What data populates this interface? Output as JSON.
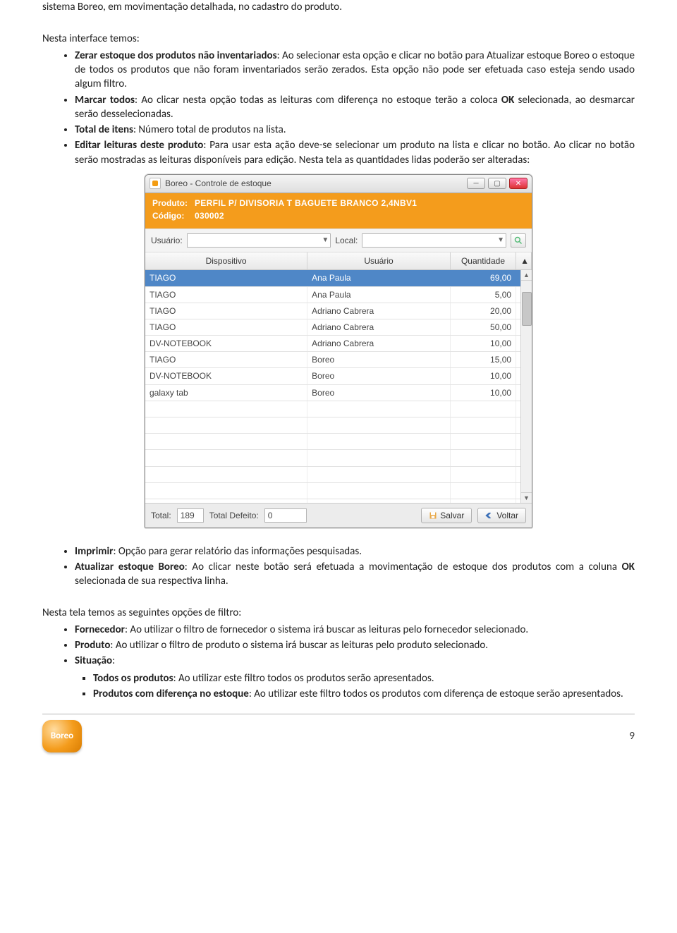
{
  "doc": {
    "intro": "sistema Boreo, em movimentação detalhada, no cadastro do produto.",
    "section1_lead": "Nesta interface temos:",
    "b1_bold": "Zerar estoque dos produtos não inventariados",
    "b1_rest": ": Ao selecionar esta opção e clicar no botão para Atualizar estoque Boreo o estoque de todos os produtos que não foram inventariados serão zerados. Esta opção não pode ser  efetuada caso esteja sendo usado algum filtro.",
    "b2_bold": "Marcar todos",
    "b2_rest": ": Ao clicar nesta opção todas as leituras com diferença no estoque terão a coloca ",
    "b2_bold2": "OK",
    "b2_rest2": " selecionada, ao desmarcar serão desselecionadas.",
    "b3_bold": "Total de itens",
    "b3_rest": ": Número total de produtos na lista.",
    "b4_bold": "Editar leituras deste produto",
    "b4_rest": ": Para usar esta ação deve-se selecionar um produto na lista e clicar no botão. Ao clicar no botão serão mostradas as leituras disponíveis para edição. Nesta tela as quantidades lidas poderão ser alteradas:",
    "b5_bold": "Imprimir",
    "b5_rest": ": Opção para gerar relatório das informações pesquisadas.",
    "b6_bold": "Atualizar estoque Boreo",
    "b6_rest": ": Ao clicar neste botão será efetuada a movimentação de estoque dos produtos com a coluna ",
    "b6_bold2": "OK",
    "b6_rest2": " selecionada de sua respectiva linha.",
    "section2_lead": "Nesta tela temos as seguintes opções de filtro:",
    "f1_bold": "Fornecedor",
    "f1_rest": ": Ao utilizar o filtro de fornecedor o sistema irá buscar as leituras pelo fornecedor selecionado.",
    "f2_bold": "Produto",
    "f2_rest": ": Ao utilizar o filtro de produto o sistema irá buscar as leituras pelo produto selecionado.",
    "f3_bold": "Situação",
    "f3_rest": ":",
    "s1_bold": "Todos os produtos",
    "s1_rest": ": Ao utilizar este filtro todos os produtos serão apresentados.",
    "s2_bold": "Produtos com diferença no estoque",
    "s2_rest": ": Ao utilizar este filtro todos os produtos com diferença de estoque serão apresentados."
  },
  "win": {
    "title": "Boreo - Controle de estoque",
    "prod_label": "Produto:",
    "prod_value": "PERFIL P/ DIVISORIA T  BAGUETE BRANCO 2,4NBV1",
    "code_label": "Código:",
    "code_value": "030002",
    "user_label": "Usuário:",
    "local_label": "Local:",
    "col1": "Dispositivo",
    "col2": "Usuário",
    "col3": "Quantidade",
    "sort": "▲",
    "rows": [
      {
        "d": "TIAGO",
        "u": "Ana Paula",
        "q": "69,00"
      },
      {
        "d": "TIAGO",
        "u": "Ana Paula",
        "q": "5,00"
      },
      {
        "d": "TIAGO",
        "u": "Adriano Cabrera",
        "q": "20,00"
      },
      {
        "d": "TIAGO",
        "u": "Adriano Cabrera",
        "q": "50,00"
      },
      {
        "d": "DV-NOTEBOOK",
        "u": "Adriano Cabrera",
        "q": "10,00"
      },
      {
        "d": "TIAGO",
        "u": "Boreo",
        "q": "15,00"
      },
      {
        "d": "DV-NOTEBOOK",
        "u": "Boreo",
        "q": "10,00"
      },
      {
        "d": "galaxy tab",
        "u": "Boreo",
        "q": "10,00"
      }
    ],
    "total_label": "Total:",
    "total_value": "189",
    "defeito_label": "Total Defeito:",
    "defeito_value": "0",
    "save": "Salvar",
    "back": "Voltar"
  },
  "footer": {
    "logo": "Boreo",
    "page": "9"
  }
}
